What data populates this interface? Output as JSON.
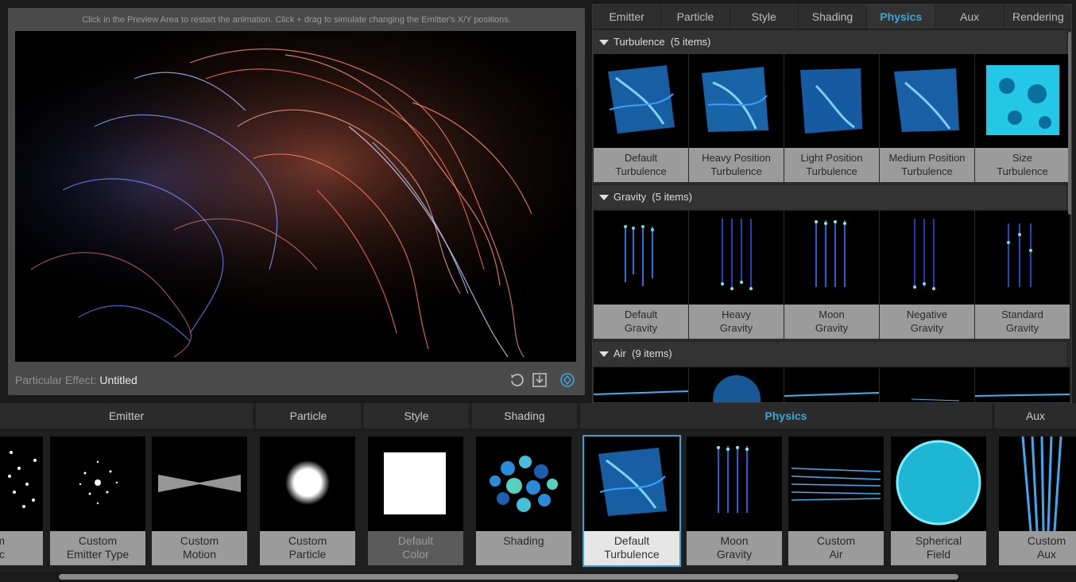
{
  "preview": {
    "hint": "Click in the Preview Area to restart the animation. Click + drag to simulate changing the Emitter's X/Y positions.",
    "effect_label": "Particular Effect:",
    "effect_name": "Untitled"
  },
  "top_tabs": [
    "Emitter",
    "Particle",
    "Style",
    "Shading",
    "Physics",
    "Aux",
    "Rendering"
  ],
  "active_tab": "Physics",
  "categories": {
    "turbulence": {
      "title": "Turbulence",
      "count": "(5 items)",
      "items": [
        "Default\nTurbulence",
        "Heavy Position\nTurbulence",
        "Light Position\nTurbulence",
        "Medium Position\nTurbulence",
        "Size\nTurbulence"
      ]
    },
    "gravity": {
      "title": "Gravity",
      "count": "(5 items)",
      "items": [
        "Default\nGravity",
        "Heavy\nGravity",
        "Moon\nGravity",
        "Negative\nGravity",
        "Standard\nGravity"
      ]
    },
    "air": {
      "title": "Air",
      "count": "(9 items)"
    }
  },
  "bottom": {
    "heads": {
      "emitter": "Emitter",
      "particle": "Particle",
      "style": "Style",
      "shading": "Shading",
      "physics": "Physics",
      "aux": "Aux"
    },
    "items": [
      "m\n/Sec",
      "Custom\nEmitter Type",
      "Custom\nMotion",
      "Custom\nParticle",
      "Default\nColor",
      "Shading",
      "Default\nTurbulence",
      "Moon\nGravity",
      "Custom\nAir",
      "Spherical\nField",
      "Custom\nAux"
    ]
  },
  "colors": {
    "accent": "#39a8d8",
    "selected_border": "#2fa4d6",
    "label_bg": "#9b9b9b"
  },
  "icons": [
    "reset-icon",
    "save-preset-icon",
    "preset-browser-icon",
    "collapse-triangle-icon"
  ]
}
